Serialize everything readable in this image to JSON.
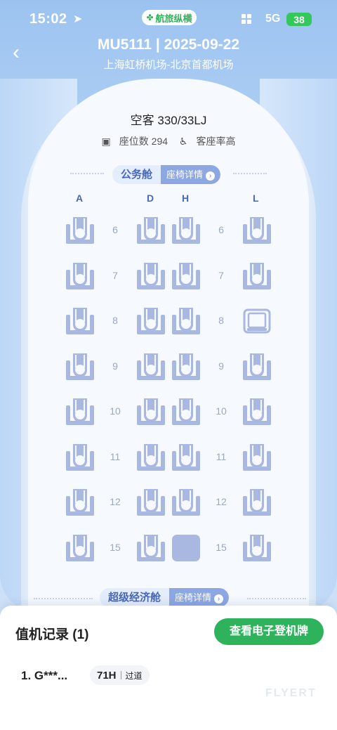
{
  "status_bar": {
    "time": "15:02",
    "app_badge": "航旅纵横",
    "network": "5G",
    "battery": "38"
  },
  "header": {
    "back_icon": "chevron-left-icon",
    "flight_title": "MU5111 | 2025-09-22",
    "route": "上海虹桥机场-北京首都机场"
  },
  "aircraft": {
    "type": "空客 330/33LJ",
    "seat_count": "座位数 294",
    "occupancy": "客座率高"
  },
  "business_cabin": {
    "name": "公务舱",
    "detail_label": "座椅详情"
  },
  "columns": [
    "A",
    "D",
    "H",
    "L"
  ],
  "rows": [
    {
      "num": "6",
      "seats": [
        "available",
        "available",
        "available",
        "available"
      ]
    },
    {
      "num": "7",
      "seats": [
        "available",
        "available",
        "available",
        "available"
      ]
    },
    {
      "num": "8",
      "seats": [
        "available",
        "available",
        "available",
        "empty"
      ]
    },
    {
      "num": "9",
      "seats": [
        "available",
        "available",
        "available",
        "available"
      ]
    },
    {
      "num": "10",
      "seats": [
        "available",
        "available",
        "available",
        "available"
      ]
    },
    {
      "num": "11",
      "seats": [
        "available",
        "available",
        "available",
        "available"
      ]
    },
    {
      "num": "12",
      "seats": [
        "available",
        "available",
        "available",
        "available"
      ]
    },
    {
      "num": "15",
      "seats": [
        "available",
        "available",
        "selected",
        "available"
      ]
    }
  ],
  "premium_cabin": {
    "name": "超级经济舱",
    "detail_label": "座椅详情"
  },
  "checkin": {
    "title": "值机记录 (1)",
    "boarding_pass_button": "查看电子登机牌",
    "passenger": "1. G***...",
    "seat": "71H",
    "position": "过道"
  },
  "watermark": "FLYERT",
  "colors": {
    "accent_blue": "#4a68b8",
    "seat_blue": "#a9b8e0",
    "green": "#2eb35c"
  }
}
